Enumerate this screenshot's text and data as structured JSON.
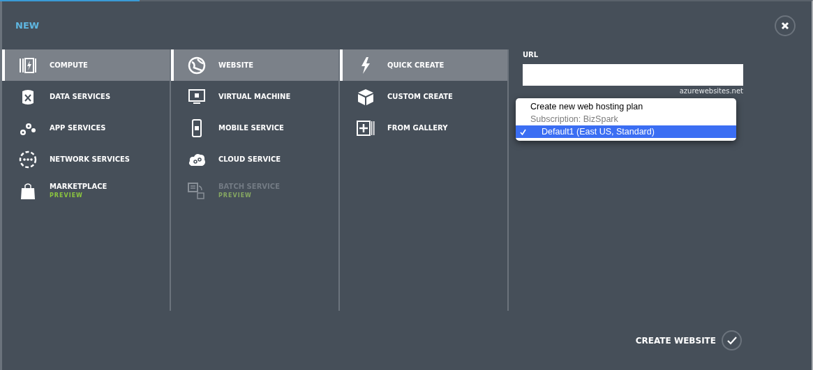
{
  "title": "NEW",
  "columns": [
    {
      "items": [
        {
          "label": "COMPUTE",
          "selected": true,
          "disabled": false
        },
        {
          "label": "DATA SERVICES",
          "selected": false,
          "disabled": false
        },
        {
          "label": "APP SERVICES",
          "selected": false,
          "disabled": false
        },
        {
          "label": "NETWORK SERVICES",
          "selected": false,
          "disabled": false
        },
        {
          "label": "MARKETPLACE",
          "badge": "PREVIEW",
          "selected": false,
          "disabled": false
        }
      ]
    },
    {
      "items": [
        {
          "label": "WEBSITE",
          "selected": true,
          "disabled": false
        },
        {
          "label": "VIRTUAL MACHINE",
          "selected": false,
          "disabled": false
        },
        {
          "label": "MOBILE SERVICE",
          "selected": false,
          "disabled": false
        },
        {
          "label": "CLOUD SERVICE",
          "selected": false,
          "disabled": false
        },
        {
          "label": "BATCH SERVICE",
          "badge": "PREVIEW",
          "selected": false,
          "disabled": true
        }
      ]
    },
    {
      "items": [
        {
          "label": "QUICK CREATE",
          "selected": true,
          "disabled": false
        },
        {
          "label": "CUSTOM CREATE",
          "selected": false,
          "disabled": false
        },
        {
          "label": "FROM GALLERY",
          "selected": false,
          "disabled": false
        }
      ]
    }
  ],
  "form": {
    "url_label": "URL",
    "url_suffix": "azurewebsites.net",
    "dropdown": [
      {
        "kind": "option",
        "label": "Create new web hosting plan",
        "selected": false
      },
      {
        "kind": "group",
        "label": "Subscription: BizSpark",
        "children": [
          {
            "kind": "option",
            "label": "Default1 (East US, Standard)",
            "selected": true
          }
        ]
      }
    ]
  },
  "action": {
    "label": "CREATE WEBSITE"
  }
}
